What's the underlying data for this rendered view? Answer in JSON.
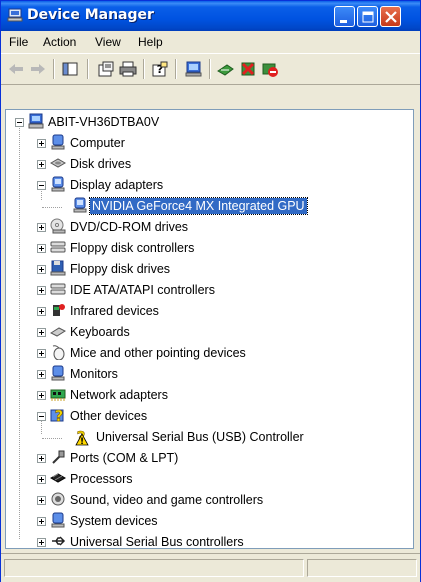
{
  "window": {
    "title": "Device Manager",
    "colors": {
      "titlebar": "#0053e1",
      "selection": "#316ac5",
      "chrome": "#ece9d8"
    }
  },
  "menu": {
    "file": "File",
    "action": "Action",
    "view": "View",
    "help": "Help"
  },
  "toolbar": {
    "icons": [
      "back-arrow-icon",
      "forward-arrow-icon",
      "show-hide-console-tree-icon",
      "properties-icon",
      "print-icon",
      "help-icon",
      "scan-hardware-icon",
      "update-driver-icon",
      "uninstall-icon",
      "disable-icon"
    ]
  },
  "tree": {
    "root": "ABIT-VH36DTBA0V",
    "computer": "Computer",
    "disk_drives": "Disk drives",
    "display_adapters": "Display adapters",
    "nvidia": "NVIDIA GeForce4 MX Integrated GPU",
    "dvd": "DVD/CD-ROM drives",
    "floppy_controllers": "Floppy disk controllers",
    "floppy_drives": "Floppy disk drives",
    "ide": "IDE ATA/ATAPI controllers",
    "infrared": "Infrared devices",
    "keyboards": "Keyboards",
    "mice": "Mice and other pointing devices",
    "monitors": "Monitors",
    "network": "Network adapters",
    "other": "Other devices",
    "usb_controller": "Universal Serial Bus (USB) Controller",
    "ports": "Ports (COM & LPT)",
    "processors": "Processors",
    "sound": "Sound, video and game controllers",
    "system": "System devices",
    "usb": "Universal Serial Bus controllers"
  },
  "status": {
    "text": ""
  }
}
